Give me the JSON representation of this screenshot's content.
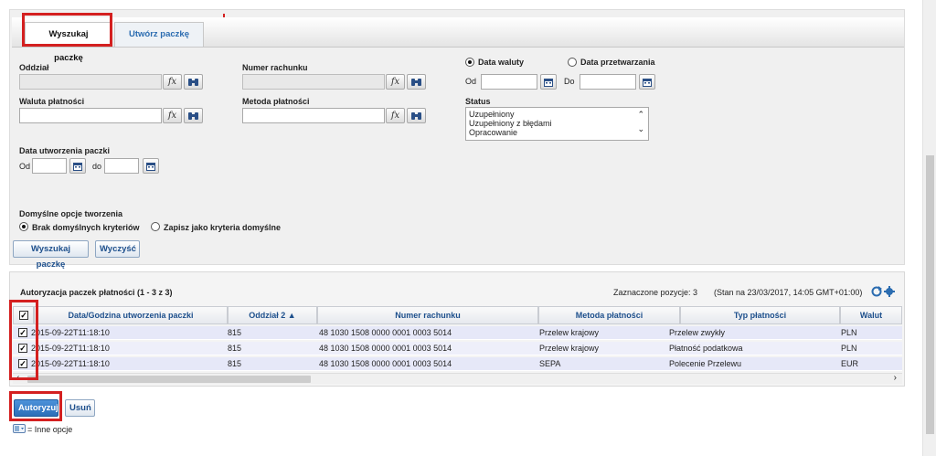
{
  "tabs": [
    {
      "label": "Wyszukaj paczkę",
      "active": true
    },
    {
      "label": "Utwórz paczkę",
      "active": false
    }
  ],
  "form": {
    "oddzial_label": "Oddział",
    "numer_rachunku_label": "Numer rachunku",
    "waluta_platnosci_label": "Waluta płatności",
    "metoda_platnosci_label": "Metoda płatności",
    "fx_symbol": "fx",
    "date_type": {
      "option_value_date": "Data waluty",
      "option_processing_date": "Data przetwarzania",
      "selected": "Data waluty",
      "from_label": "Od",
      "to_label": "Do"
    },
    "status_label": "Status",
    "status_options": [
      "Uzupełniony",
      "Uzupełniony z błędami",
      "Opracowanie"
    ],
    "created_label": "Data utworzenia paczki",
    "created_from_label": "Od",
    "created_to_label": "do",
    "default_options_label": "Domyślne opcje tworzenia",
    "default_option_none": "Brak domyślnych kryteriów",
    "default_option_save": "Zapisz jako kryteria domyślne",
    "default_selected": "Brak domyślnych kryteriów",
    "search_button": "Wyszukaj paczkę",
    "clear_button": "Wyczyść"
  },
  "grid": {
    "title": "Autoryzacja paczek płatności (1 - 3 z 3)",
    "selected_count": "Zaznaczone pozycje: 3",
    "status_time": "(Stan na 23/03/2017, 14:05 GMT+01:00)",
    "columns": [
      "Data/Godzina utworzenia paczki",
      "Oddział",
      "Numer rachunku",
      "Metoda płatności",
      "Typ płatności",
      "Walut"
    ],
    "sort_indicator": "2 ▲",
    "rows": [
      {
        "date": "2015-09-22T11:18:10",
        "branch": "815",
        "account": "48 1030 1508 0000 0001 0003 5014",
        "method": "Przelew krajowy",
        "type": "Przelew zwykły",
        "currency": "PLN"
      },
      {
        "date": "2015-09-22T11:18:10",
        "branch": "815",
        "account": "48 1030 1508 0000 0001 0003 5014",
        "method": "Przelew krajowy",
        "type": "Płatność podatkowa",
        "currency": "PLN"
      },
      {
        "date": "2015-09-22T11:18:10",
        "branch": "815",
        "account": "48 1030 1508 0000 0001 0003 5014",
        "method": "SEPA",
        "type": "Polecenie Przelewu",
        "currency": "EUR"
      }
    ]
  },
  "actions": {
    "authorize_button": "Autoryzuj",
    "delete_button": "Usuń",
    "more_options_legend": "= Inne opcje"
  },
  "colors": {
    "highlight": "#d42020",
    "link": "#2b6cb0",
    "row_bg": "#e6e8f8"
  }
}
